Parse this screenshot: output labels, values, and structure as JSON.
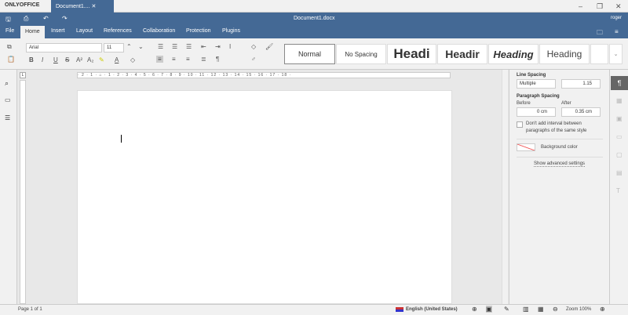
{
  "app": {
    "logo": "ONLYOFFICE",
    "tab": "Document1....",
    "title": "Document1.docx",
    "user": "roger"
  },
  "menu": [
    "File",
    "Home",
    "Insert",
    "Layout",
    "References",
    "Collaboration",
    "Protection",
    "Plugins"
  ],
  "font": {
    "name": "Arial",
    "size": "11"
  },
  "styles": [
    "Normal",
    "No Spacing",
    "Headi",
    "Headir",
    "Heading",
    "Heading"
  ],
  "ruler": "· 2 · 1 · ⌂ · 1 · 2 · 3 · 4 · 5 · 6 · 7 · 8 · 9 · 10 · 11 · 12 · 13 · 14 · 15 · 16 · 17 · 18 ·",
  "panel": {
    "line_spacing": "Line Spacing",
    "line_mode": "Multiple",
    "line_value": "1.15",
    "para_spacing": "Paragraph Spacing",
    "before_label": "Before",
    "after_label": "After",
    "before": "0 cm",
    "after": "0.35 cm",
    "no_interval": "Don't add interval between paragraphs of the same style",
    "bg_color": "Background color",
    "advanced": "Show advanced settings"
  },
  "status": {
    "page": "Page 1 of 1",
    "language": "English (United States)",
    "zoom": "Zoom 100%"
  }
}
